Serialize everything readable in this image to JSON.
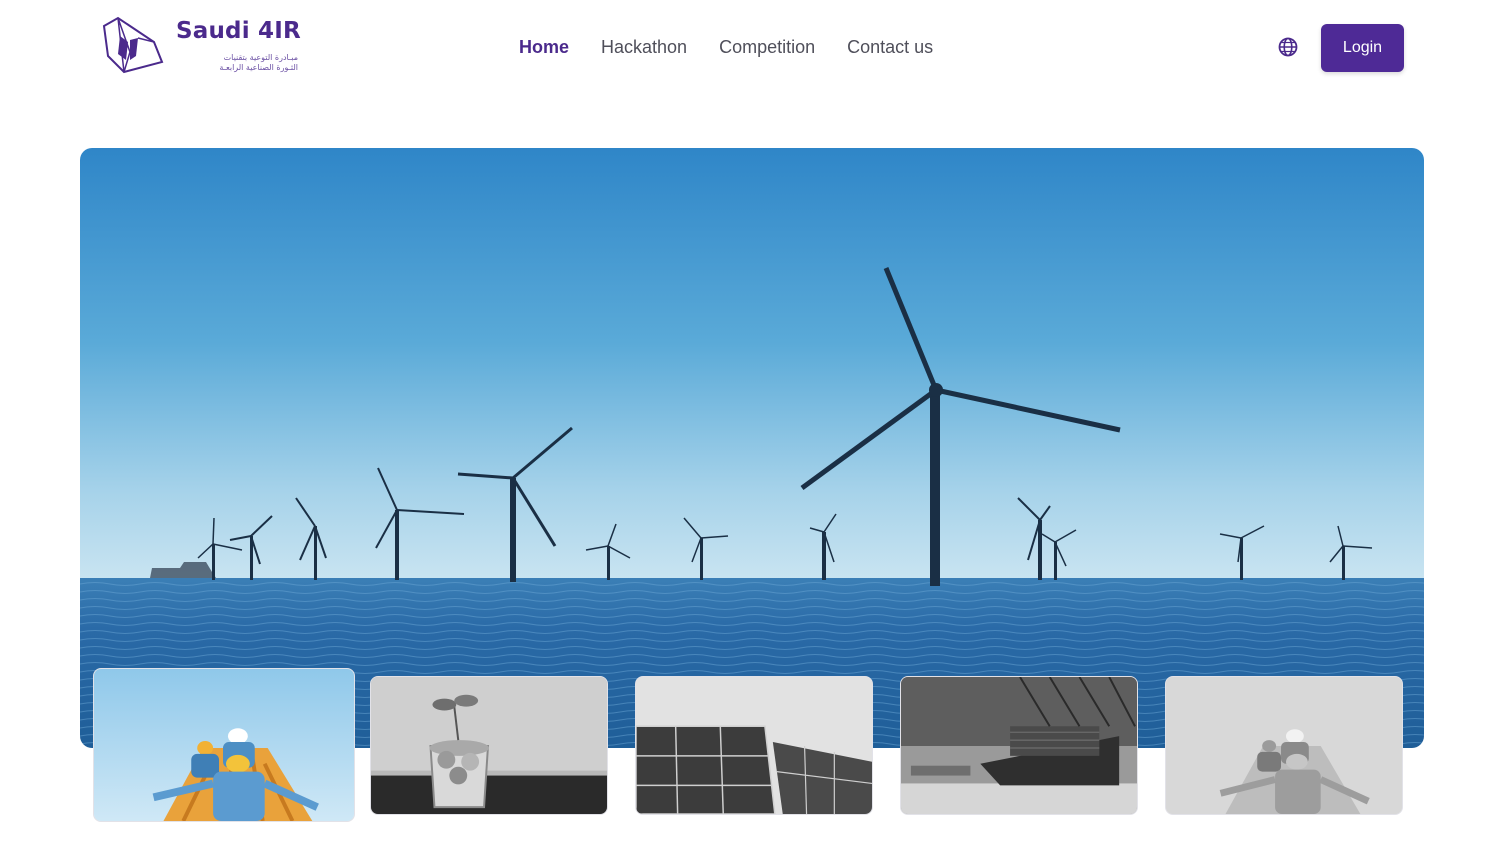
{
  "brand": {
    "name": "Saudi 4IR",
    "arabic_line1": "مبـادرة التوعية بتقنيات",
    "arabic_line2": "الثـورة الصناعية الرابعـة",
    "color": "#4b2a8c"
  },
  "nav": {
    "items": [
      {
        "label": "Home",
        "active": true
      },
      {
        "label": "Hackathon",
        "active": false
      },
      {
        "label": "Competition",
        "active": false
      },
      {
        "label": "Contact us",
        "active": false
      }
    ]
  },
  "header": {
    "language_icon": "globe-icon",
    "login_label": "Login",
    "login_color": "#4e2a96"
  },
  "hero": {
    "image": "offshore-wind-turbines-at-sea"
  },
  "thumbnails": [
    {
      "image": "workers-in-hard-hats-color",
      "selected": true
    },
    {
      "image": "coins-in-glass-with-sprout-grayscale",
      "selected": false
    },
    {
      "image": "solar-panels-grayscale",
      "selected": false
    },
    {
      "image": "cargo-ship-port-cranes-grayscale",
      "selected": false
    },
    {
      "image": "workers-in-hard-hats-grayscale",
      "selected": false
    }
  ]
}
